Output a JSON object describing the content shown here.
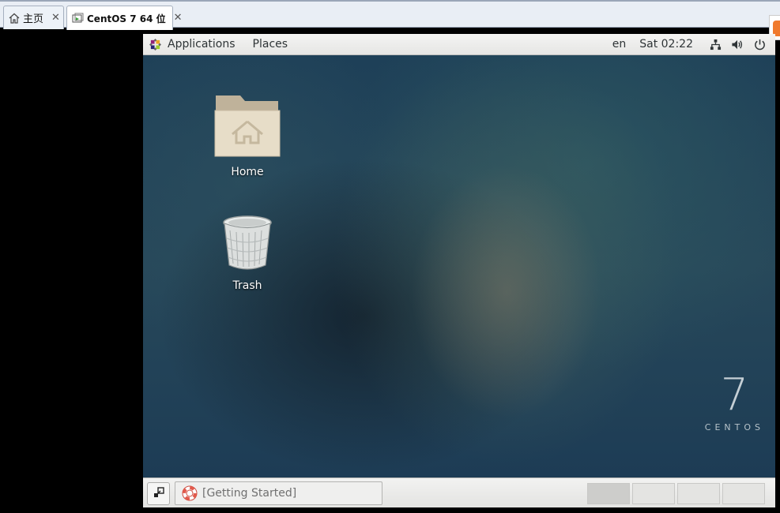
{
  "vm_tabs": {
    "items": [
      {
        "label": "主页",
        "icon": "home-icon"
      },
      {
        "label": "CentOS 7 64 位",
        "icon": "vm-icon"
      }
    ],
    "close_glyph": "✕"
  },
  "topbar": {
    "applications_label": "Applications",
    "places_label": "Places",
    "language": "en",
    "clock": "Sat 02:22",
    "icons": [
      "network-icon",
      "volume-icon",
      "power-icon"
    ]
  },
  "desktop": {
    "icons": [
      {
        "label": "Home",
        "icon": "home-folder-icon"
      },
      {
        "label": "Trash",
        "icon": "trash-icon"
      }
    ],
    "brand": {
      "number": "7",
      "word": "CENTOS"
    }
  },
  "taskbar": {
    "task_label": "[Getting Started]",
    "workspace_count": 4,
    "active_workspace": 1
  }
}
